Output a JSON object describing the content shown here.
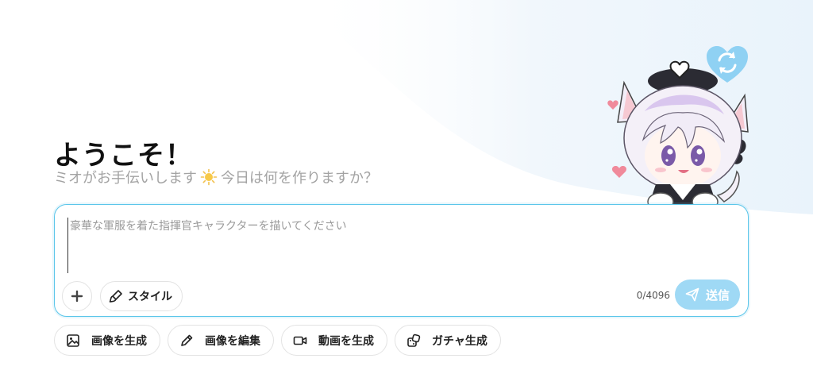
{
  "welcome": {
    "title": "ようこそ！",
    "subtitle_before": "ミオがお手伝いします",
    "subtitle_after": "今日は何を作りますか？"
  },
  "prompt": {
    "placeholder": "豪華な軍服を着た指揮官キャラクターを描いてください",
    "value": "",
    "char_count": "0/4096"
  },
  "toolbar": {
    "style_label": "スタイル",
    "send_label": "送信"
  },
  "quick_actions": [
    {
      "label": "画像を生成",
      "icon": "image-icon"
    },
    {
      "label": "画像を編集",
      "icon": "pencil-icon"
    },
    {
      "label": "動画を生成",
      "icon": "video-camera-icon"
    },
    {
      "label": "ガチャ生成",
      "icon": "gacha-dice-icon"
    }
  ],
  "colors": {
    "accent": "#5bc6ea",
    "send_button": "#9fd9f5",
    "heart_refresh": "#8fd1f3",
    "background_wash": "#eef6fc"
  }
}
